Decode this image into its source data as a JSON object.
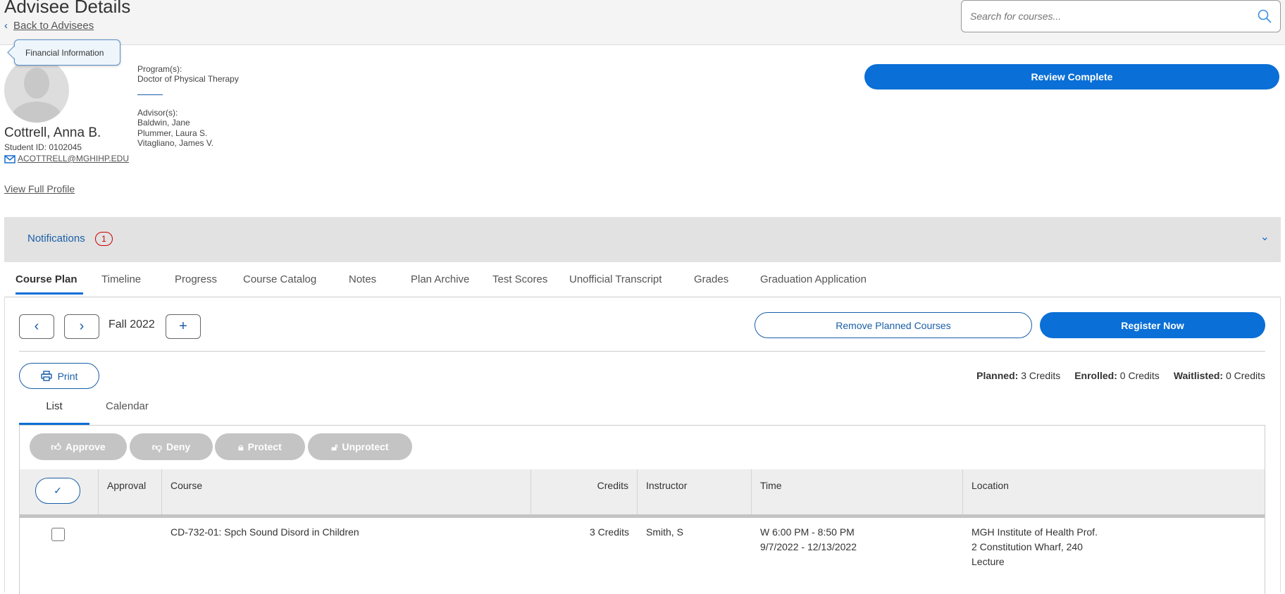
{
  "header": {
    "title": "Advisee Details",
    "back_label": "Back to Advisees",
    "search_placeholder": "Search for courses..."
  },
  "tooltip": "Financial Information",
  "student": {
    "name": "Cottrell, Anna B.",
    "student_id": "Student ID: 0102045",
    "email": "ACOTTRELL@MGHIHP.EDU",
    "view_profile": "View Full Profile",
    "programs_label": "Program(s):",
    "program": "Doctor of Physical Therapy",
    "advisors_label": "Advisor(s):",
    "advisors": [
      "Baldwin, Jane",
      "Plummer, Laura S.",
      "Vitagliano, James V."
    ]
  },
  "review_complete": "Review Complete",
  "notifications": {
    "label": "Notifications",
    "count": "1"
  },
  "tabs": [
    {
      "label": "Course Plan",
      "active": true
    },
    {
      "label": "Timeline"
    },
    {
      "label": "Progress"
    },
    {
      "label": "Course Catalog"
    },
    {
      "label": "Notes"
    },
    {
      "label": "Plan Archive"
    },
    {
      "label": "Test Scores"
    },
    {
      "label": "Unofficial Transcript"
    },
    {
      "label": "Grades"
    },
    {
      "label": "Graduation Application"
    }
  ],
  "plan": {
    "term": "Fall 2022",
    "remove_label": "Remove Planned Courses",
    "register_label": "Register Now",
    "print_label": "Print",
    "summary": {
      "planned_label": "Planned:",
      "planned": "3 Credits",
      "enrolled_label": "Enrolled:",
      "enrolled": "0 Credits",
      "waitlisted_label": "Waitlisted:",
      "waitlisted": "0 Credits"
    },
    "view_tabs": [
      "List",
      "Calendar"
    ],
    "actions": [
      "Approve",
      "Deny",
      "Protect",
      "Unprotect"
    ],
    "columns": [
      "Approval",
      "Course",
      "Credits",
      "Instructor",
      "Time",
      "Location"
    ],
    "rows": [
      {
        "approval": "",
        "course": "CD-732-01: Spch Sound Disord in Children",
        "credits": "3 Credits",
        "instructor": "Smith, S",
        "time": [
          "W 6:00 PM - 8:50 PM",
          "9/7/2022 - 12/13/2022"
        ],
        "location": [
          "MGH Institute of Health Prof.",
          "2 Constitution Wharf, 240",
          "Lecture"
        ]
      }
    ]
  },
  "colors": {
    "accent": "#0a6fd6",
    "link": "#1a5fa8"
  }
}
